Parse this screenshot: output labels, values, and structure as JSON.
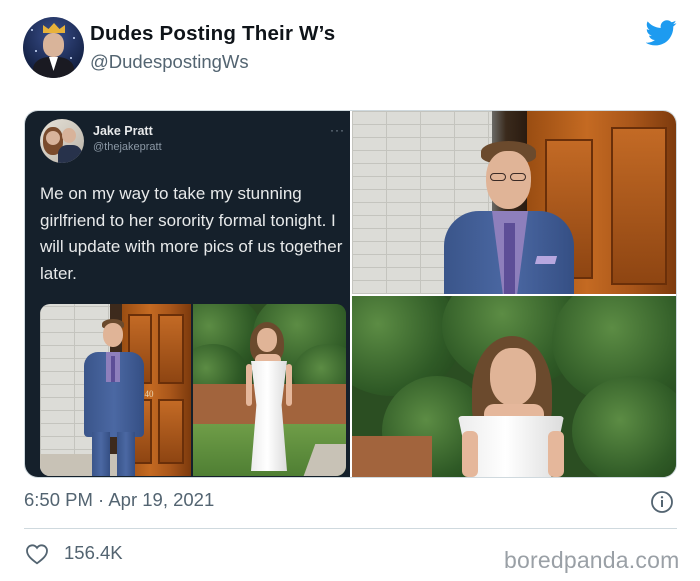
{
  "author": {
    "display_name": "Dudes Posting Their W’s",
    "handle": "@DudespostingWs",
    "avatar_icon": "profile-avatar",
    "platform_icon": "twitter-bird-icon"
  },
  "embedded_tweet": {
    "author_name": "Jake Pratt",
    "author_handle": "@thejakepratt",
    "more_label": "···",
    "text": "Me on my way to take my stunning girlfriend to her sorority formal tonight. I will update with more pics of us together later.",
    "door_number": "240"
  },
  "footer": {
    "timestamp": "6:50 PM · Apr 19, 2021",
    "like_count": "156.4K"
  },
  "watermark": "boredpanda.com",
  "colors": {
    "twitter_blue": "#1d9bf0",
    "dark_tweet_bg": "#15202b",
    "muted_text": "#536471"
  }
}
